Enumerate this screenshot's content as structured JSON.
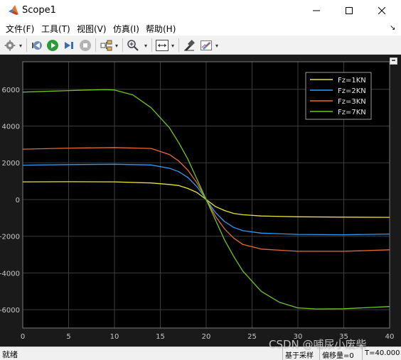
{
  "window": {
    "title": "Scope1"
  },
  "menu": [
    "文件(F)",
    "工具(T)",
    "视图(V)",
    "仿真(I)",
    "帮助(H)"
  ],
  "toolbar": {
    "buttons": [
      "settings-icon",
      "dropdown-arrow",
      "step-back-icon",
      "run-icon",
      "step-forward-icon",
      "stop-icon",
      "highlight-icon",
      "dropdown-arrow",
      "zoom-icon",
      "dropdown-arrow",
      "autoscale-icon",
      "dropdown-arrow",
      "property-inspector-icon",
      "style-icon",
      "dropdown-arrow"
    ]
  },
  "chart_data": {
    "type": "line",
    "xlim": [
      0,
      40
    ],
    "ylim": [
      -7000,
      7500
    ],
    "xticks": [
      0,
      5,
      10,
      15,
      20,
      25,
      30,
      35,
      40
    ],
    "yticks": [
      -6000,
      -4000,
      -2000,
      0,
      2000,
      4000,
      6000
    ],
    "grid": true,
    "legend_position": "top-right",
    "series": [
      {
        "name": "Fz=1KN",
        "color": "#e8e23c",
        "x": [
          0,
          5,
          10,
          14,
          16,
          17,
          18,
          19,
          20,
          21,
          22,
          23,
          24,
          26,
          30,
          35,
          40
        ],
        "y": [
          960,
          970,
          960,
          900,
          820,
          760,
          600,
          380,
          0,
          -380,
          -600,
          -760,
          -830,
          -900,
          -940,
          -960,
          -970
        ]
      },
      {
        "name": "Fz=2KN",
        "color": "#2e9cf3",
        "x": [
          0,
          5,
          10,
          14,
          16,
          17,
          18,
          19,
          20,
          21,
          22,
          23,
          24,
          26,
          30,
          35,
          40
        ],
        "y": [
          1870,
          1900,
          1920,
          1880,
          1700,
          1520,
          1200,
          700,
          0,
          -700,
          -1200,
          -1520,
          -1700,
          -1830,
          -1900,
          -1920,
          -1880
        ]
      },
      {
        "name": "Fz=3KN",
        "color": "#e96a32",
        "x": [
          0,
          5,
          10,
          14,
          16,
          17,
          18,
          19,
          20,
          21,
          22,
          23,
          24,
          26,
          30,
          35,
          40
        ],
        "y": [
          2740,
          2800,
          2830,
          2780,
          2450,
          2100,
          1600,
          900,
          0,
          -900,
          -1600,
          -2100,
          -2450,
          -2700,
          -2820,
          -2820,
          -2740
        ]
      },
      {
        "name": "Fz=7KN",
        "color": "#6cc81d",
        "x": [
          0,
          5,
          9,
          10,
          12,
          14,
          16,
          17,
          18,
          19,
          20,
          21,
          22,
          23,
          24,
          26,
          28,
          30,
          32,
          35,
          40
        ],
        "y": [
          5850,
          5930,
          5990,
          5960,
          5700,
          5000,
          3900,
          3100,
          2200,
          1100,
          0,
          -1100,
          -2200,
          -3100,
          -3900,
          -5000,
          -5600,
          -5900,
          -5960,
          -5950,
          -5830
        ]
      }
    ]
  },
  "status": {
    "left": "就绪",
    "sample_mode": "基于采样",
    "offset": "偏移量=0",
    "time": "T=40.000"
  },
  "watermark": "CSDN @哺尿小废柴"
}
